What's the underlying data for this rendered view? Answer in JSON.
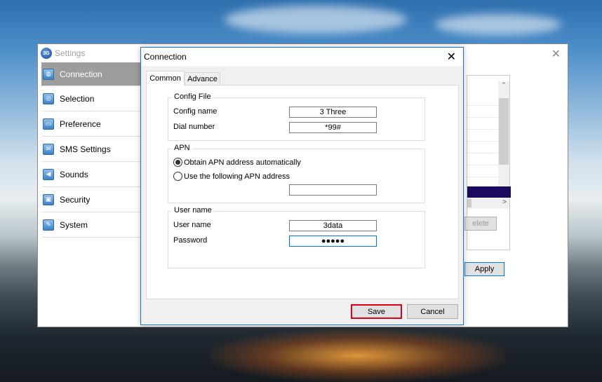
{
  "settings": {
    "title": "Settings",
    "logo_text": "3G",
    "close_glyph": "✕",
    "sidebar": [
      {
        "label": "Connection",
        "icon": "globe-icon",
        "glyph": "◍",
        "active": true
      },
      {
        "label": "Selection",
        "icon": "target-icon",
        "glyph": "◎"
      },
      {
        "label": "Preference",
        "icon": "monitor-icon",
        "glyph": "▭"
      },
      {
        "label": "SMS Settings",
        "icon": "envelope-icon",
        "glyph": "✉"
      },
      {
        "label": "Sounds",
        "icon": "speaker-icon",
        "glyph": "◀"
      },
      {
        "label": "Security",
        "icon": "lock-icon",
        "glyph": "▣"
      },
      {
        "label": "System",
        "icon": "wrench-icon",
        "glyph": "✎"
      }
    ],
    "delete_label": "elete",
    "apply_label": "Apply",
    "scroll_up": "⌃",
    "scroll_down": "⌄",
    "scroll_right": ">"
  },
  "dialog": {
    "title": "Connection",
    "close_glyph": "✕",
    "tabs": [
      "Common",
      "Advance"
    ],
    "config_file": {
      "group_title": "Config File",
      "config_name_label": "Config name",
      "config_name_value": "3 Three",
      "dial_number_label": "Dial number",
      "dial_number_value": "*99#"
    },
    "apn": {
      "group_title": "APN",
      "auto_label": "Obtain APN address automatically",
      "manual_label": "Use the following APN address",
      "address_value": ""
    },
    "user": {
      "group_title": "User name",
      "user_label": "User name",
      "user_value": "3data",
      "password_label": "Password",
      "password_value": "●●●●●"
    },
    "save_label": "Save",
    "cancel_label": "Cancel"
  },
  "colors": {
    "active_sidebar": "#9d9d9d",
    "dialog_border": "#1f76c8",
    "save_highlight": "#e0001a",
    "list_selection": "#1c0a5e"
  }
}
